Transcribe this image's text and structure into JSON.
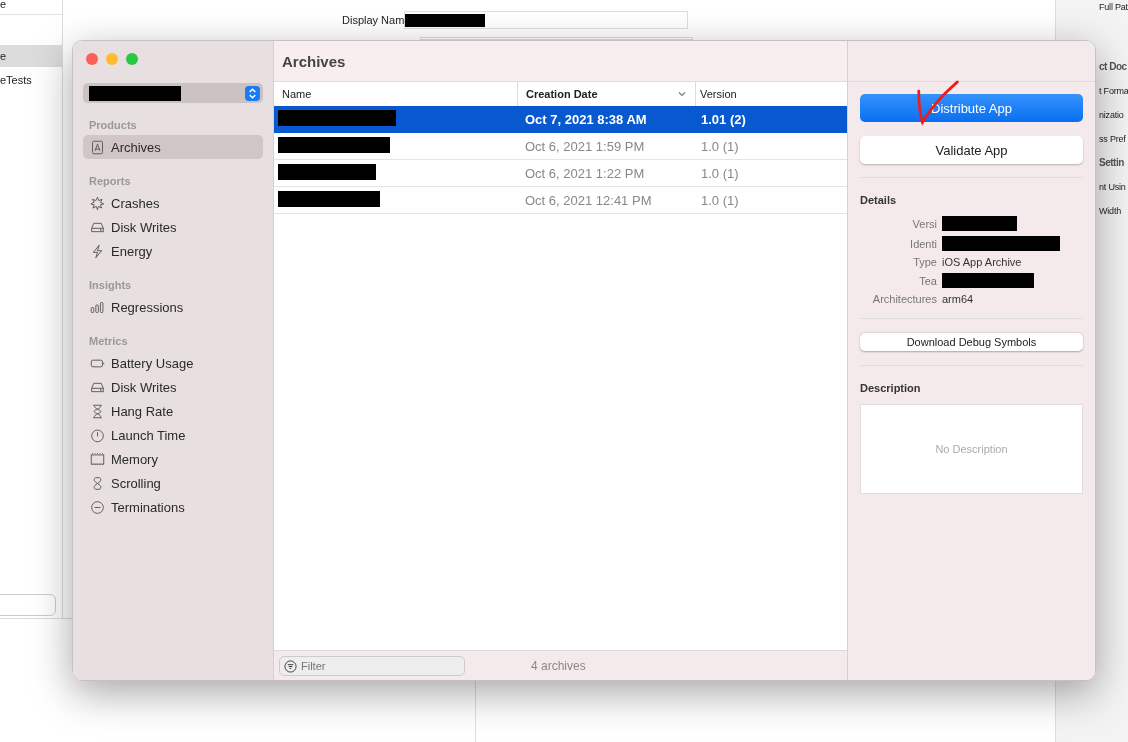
{
  "background_window": {
    "sidebar_items": [
      {
        "label": "e",
        "selected": false
      },
      {
        "label": "e",
        "selected": true
      },
      {
        "label": "eTests",
        "selected": false
      }
    ],
    "form": {
      "label": "Display Nam",
      "redacted": true
    },
    "inspector": [
      {
        "text": "Full Pat",
        "kind": "plain"
      },
      {
        "text": "ct Doc",
        "kind": "heading"
      },
      {
        "text": "t Forma",
        "kind": "plain"
      },
      {
        "text": "nizatio",
        "kind": "plain"
      },
      {
        "text": "ss Pref",
        "kind": "plain"
      },
      {
        "text": "Settin",
        "kind": "heading"
      },
      {
        "text": "nt Usin",
        "kind": "plain"
      },
      {
        "text": "Width",
        "kind": "plain"
      }
    ]
  },
  "window": {
    "title": "Archives",
    "sidebar": {
      "scheme_redacted": true,
      "sections": [
        {
          "title": "Products",
          "items": [
            {
              "label": "Archives",
              "selected": true
            }
          ]
        },
        {
          "title": "Reports",
          "items": [
            {
              "label": "Crashes",
              "selected": false
            },
            {
              "label": "Disk Writes",
              "selected": false
            },
            {
              "label": "Energy",
              "selected": false
            }
          ]
        },
        {
          "title": "Insights",
          "items": [
            {
              "label": "Regressions",
              "selected": false
            }
          ]
        },
        {
          "title": "Metrics",
          "items": [
            {
              "label": "Battery Usage",
              "selected": false
            },
            {
              "label": "Disk Writes",
              "selected": false
            },
            {
              "label": "Hang Rate",
              "selected": false
            },
            {
              "label": "Launch Time",
              "selected": false
            },
            {
              "label": "Memory",
              "selected": false
            },
            {
              "label": "Scrolling",
              "selected": false
            },
            {
              "label": "Terminations",
              "selected": false
            }
          ]
        }
      ]
    },
    "table": {
      "columns": [
        "Name",
        "Creation Date",
        "Version"
      ],
      "rows": [
        {
          "name_redacted": true,
          "date": "Oct 7, 2021 8:38 AM",
          "version": "1.01 (2)",
          "selected": true
        },
        {
          "name_redacted": true,
          "date": "Oct 6, 2021 1:59 PM",
          "version": "1.0 (1)",
          "selected": false
        },
        {
          "name_redacted": true,
          "date": "Oct 6, 2021 1:22 PM",
          "version": "1.0 (1)",
          "selected": false
        },
        {
          "name_redacted": true,
          "date": "Oct 6, 2021 12:41 PM",
          "version": "1.0 (1)",
          "selected": false
        }
      ]
    },
    "filter": {
      "placeholder": "Filter"
    },
    "count": "4 archives",
    "actions": {
      "primary": "Distribute App",
      "secondary": "Validate App"
    },
    "details": {
      "title": "Details",
      "fields": [
        {
          "label": "Versi",
          "value_redacted": true
        },
        {
          "label": "Identi",
          "value_redacted": true
        },
        {
          "label": "Type",
          "value": "iOS App Archive"
        },
        {
          "label": "Tea",
          "value_redacted": true
        },
        {
          "label": "Architectures",
          "value": "arm64"
        }
      ]
    },
    "debug_button": "Download Debug Symbols",
    "description": {
      "title": "Description",
      "placeholder": "No Description"
    }
  }
}
